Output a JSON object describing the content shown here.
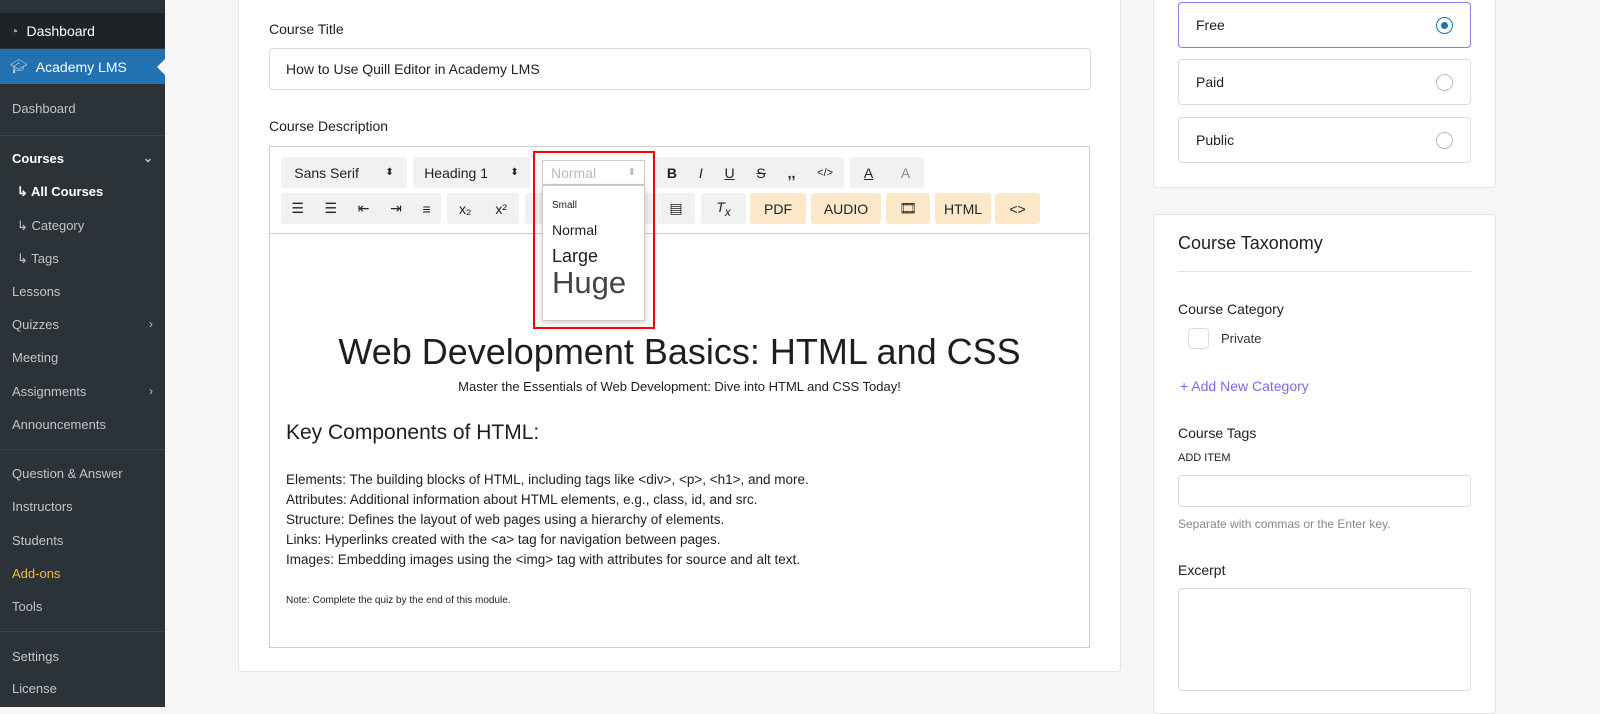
{
  "sidebar": {
    "top": [
      {
        "label": "Dashboard",
        "icon": "gauge-icon"
      },
      {
        "label": "Academy LMS",
        "icon": "graduation-cap-icon"
      }
    ],
    "items": [
      "Dashboard",
      "Courses",
      "↳ All Courses",
      "↳ Category",
      "↳ Tags",
      "Lessons",
      "Quizzes",
      "Meeting",
      "Assignments",
      "Announcements",
      "Question & Answer",
      "Instructors",
      "Students",
      "Add-ons",
      "Tools",
      "Settings",
      "License"
    ]
  },
  "form": {
    "title_label": "Course Title",
    "title_value": "How to Use Quill Editor in Academy LMS",
    "desc_label": "Course Description"
  },
  "toolbar": {
    "font": "Sans Serif",
    "heading": "Heading 1",
    "size": "Normal",
    "size_options": [
      "Small",
      "Normal",
      "Large",
      "Huge"
    ],
    "sub": "x₂",
    "sup": "x²",
    "pdf": "PDF",
    "audio": "AUDIO",
    "html": "HTML",
    "code": "<>"
  },
  "editor": {
    "heading": "Web Development Basics: HTML and CSS",
    "subtitle": "Master the Essentials of Web Development: Dive into HTML and CSS Today!",
    "h2": "Key Components of HTML:",
    "lines": [
      "Elements: The building blocks of HTML, including tags like <div>, <p>, <h1>, and more.",
      "Attributes: Additional information about HTML elements, e.g., class, id, and src.",
      "Structure: Defines the layout of web pages using a hierarchy of elements.",
      "Links: Hyperlinks created with the <a> tag for navigation between pages.",
      "Images: Embedding images using the <img> tag with attributes for source and alt text."
    ],
    "note": "Note: Complete the quiz by the end of this module."
  },
  "access": {
    "options": [
      "Free",
      "Paid",
      "Public"
    ],
    "selected": "Free"
  },
  "taxonomy": {
    "title": "Course Taxonomy",
    "category_label": "Course Category",
    "category_option": "Private",
    "add_category": "+ Add New Category",
    "tags_label": "Course Tags",
    "add_item": "ADD ITEM",
    "tags_help": "Separate with commas or the Enter key.",
    "excerpt_label": "Excerpt"
  },
  "colors": {
    "accent": "#2271b1",
    "addons": "#f0b849",
    "link": "#7b68ee",
    "highlight": "#ff0000"
  }
}
